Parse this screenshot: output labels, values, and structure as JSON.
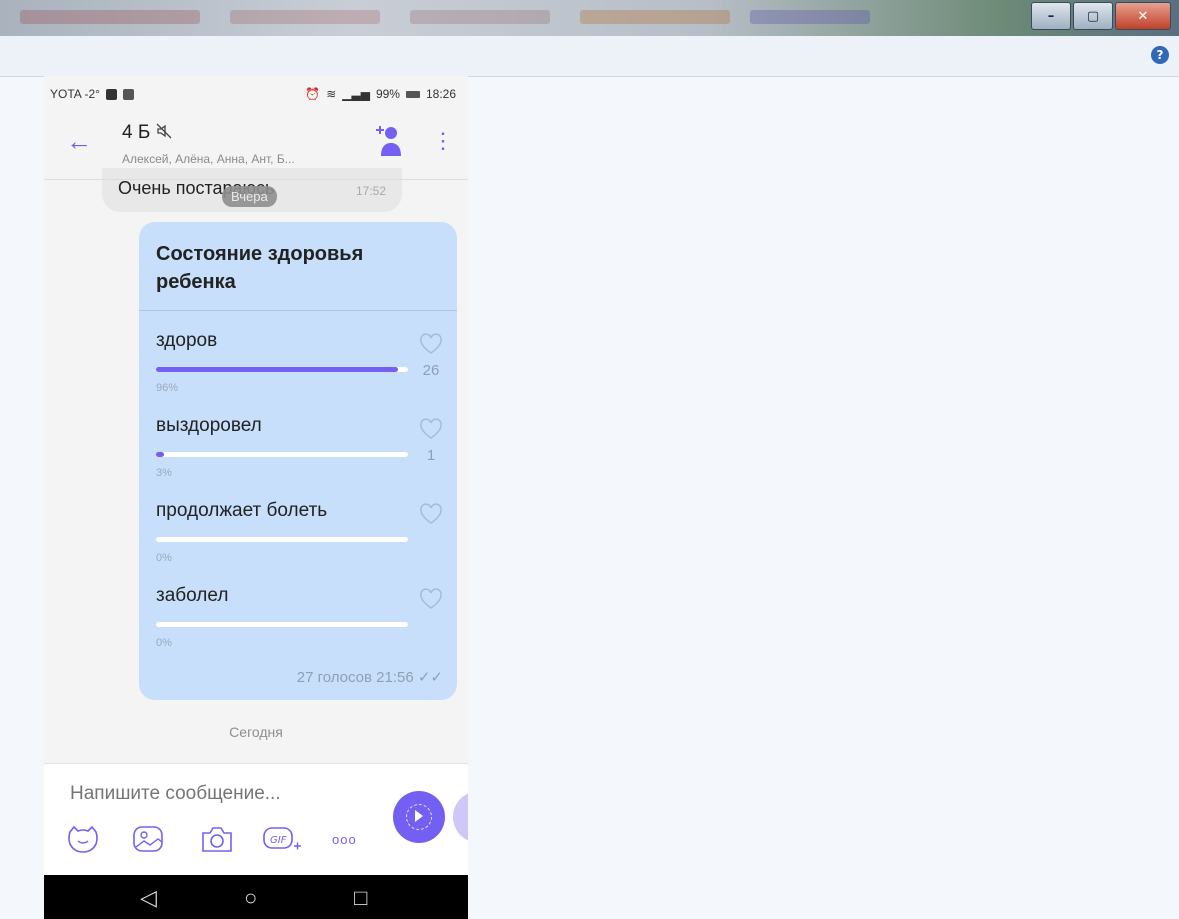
{
  "status_bar": {
    "carrier": "YOTA -2°",
    "right": "99%",
    "time": "18:26"
  },
  "chat": {
    "title": "4 Б",
    "subtitle": "Алексей, Алёна, Анна, Ант, Б...",
    "prev_message": {
      "text": "Очень постараюсь",
      "time": "17:52"
    },
    "date_chip": "Вчера",
    "poll": {
      "question": "Состояние здоровья ребенка",
      "options": [
        {
          "label": "здоров",
          "percent_text": "96%",
          "percent": 96,
          "count": "26"
        },
        {
          "label": "выздоровел",
          "percent_text": "3%",
          "percent": 3,
          "count": "1"
        },
        {
          "label": "продолжает болеть",
          "percent_text": "0%",
          "percent": 0,
          "count": ""
        },
        {
          "label": "заболел",
          "percent_text": "0%",
          "percent": 0,
          "count": ""
        }
      ],
      "footer": "27 голосов 21:56"
    },
    "today_label": "Сегодня",
    "input_placeholder": "Напишите сообщение..."
  },
  "colors": {
    "accent": "#7360f2",
    "poll_bg": "#c7dffa"
  },
  "icons": [
    "back-arrow-icon",
    "mute-icon",
    "add-participant-icon",
    "more-vert-icon",
    "sticker-icon",
    "gallery-icon",
    "camera-icon",
    "gif-icon",
    "more-dots-icon",
    "help-icon"
  ]
}
